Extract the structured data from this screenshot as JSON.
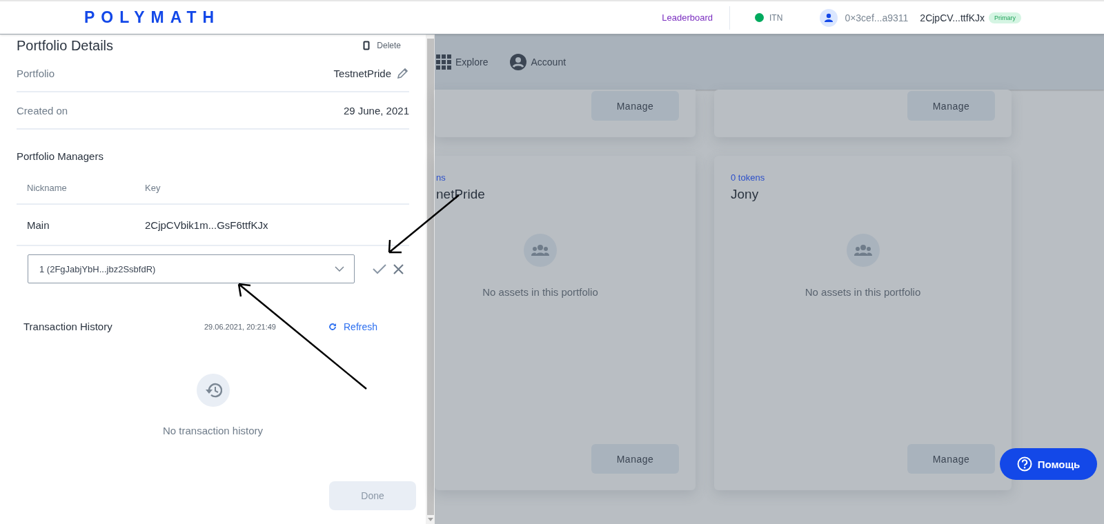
{
  "header": {
    "logo": "POLYMATH",
    "nav_link": "Leaderboard",
    "network": "ITN",
    "address": "0×3cef...a9311",
    "account": "2CjpCV...ttfKJx",
    "badge": "Primary"
  },
  "drawer": {
    "title": "Portfolio Details",
    "delete_label": "Delete",
    "details": [
      {
        "label": "Portfolio",
        "value": "TestnetPride",
        "editable": true
      },
      {
        "label": "Created on",
        "value": "29 June, 2021",
        "editable": false
      }
    ],
    "managers": {
      "title": "Portfolio Managers",
      "columns": [
        "Nickname",
        "Key"
      ],
      "rows": [
        {
          "nickname": "Main",
          "key": "2CjpCVbik1m...GsF6ttfKJx"
        }
      ],
      "select": {
        "value": "1 (2FgJabjYbH...jbz2SsbfdR)"
      }
    },
    "history": {
      "title": "Transaction History",
      "timestamp": "29.06.2021, 20:21:49",
      "refresh": "Refresh",
      "empty": "No transaction history"
    },
    "done": {
      "label": "Done",
      "disabled": true
    }
  },
  "subnav": [
    {
      "label": "Explore",
      "kind": "grid"
    },
    {
      "label": "Account",
      "kind": "account"
    }
  ],
  "cards": [
    {
      "kind": "top",
      "button": "Manage"
    },
    {
      "kind": "top",
      "button": "Manage"
    },
    {
      "kind": "portfolio",
      "tokens": "ns",
      "name": "netPride",
      "empty": "No assets in this portfolio",
      "button": "Manage"
    },
    {
      "kind": "portfolio",
      "tokens": "0 tokens",
      "name": "Jony",
      "empty": "No assets in this portfolio",
      "button": "Manage"
    }
  ],
  "help_button": "Помощь"
}
